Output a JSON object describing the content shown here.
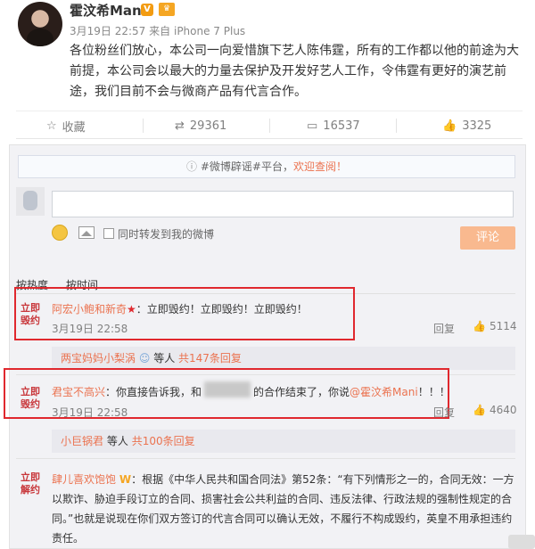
{
  "post": {
    "author": "霍汶希Mani",
    "badge": "V",
    "date": "3月19日 22:57",
    "source_prefix": "来自",
    "source": "iPhone 7 Plus",
    "text": "各位粉丝们放心，本公司一向爱惜旗下艺人陈伟霆，所有的工作都以他的前途为大前提，本公司会以最大的力量去保护及开发好艺人工作，令伟霆有更好的演艺前途，我们目前不会与微商产品有代言合作。"
  },
  "actions": {
    "favorite": "收藏",
    "repost": "29361",
    "comment": "16537",
    "like": "3325"
  },
  "comment_area": {
    "notice_tag": "#微博辟谣#平台，",
    "notice_link": "欢迎查阅！",
    "repost_label": "同时转发到我的微博",
    "submit": "评论",
    "tab_hot": "按热度",
    "tab_time": "按时间"
  },
  "comments": [
    {
      "stamp": "立即毁约",
      "name": "阿宏小鲍和新奇",
      "text": "：立即毁约！立即毁约！立即毁约！",
      "time": "3月19日 22:58",
      "reply": "回复",
      "likes": "5114",
      "sub_names": "两宝妈妈小梨涡",
      "sub_mid": "等人",
      "sub_count": "共147条回复"
    },
    {
      "stamp": "立即毁约",
      "name": "君宝不高兴",
      "text_a": "：你直接告诉我，和",
      "text_b": "的合作结束了，你说",
      "mention": "@霍汶希Mani",
      "text_c": "！！！",
      "time": "3月19日 22:58",
      "reply": "回复",
      "likes": "4640",
      "sub_names": "小巨锅君",
      "sub_mid": "等人",
      "sub_count": "共100条回复"
    },
    {
      "stamp": "立即解约",
      "name": "肆儿喜欢饱饱",
      "badge": "W",
      "text": "：根据《中华人民共和国合同法》第52条：“有下列情形之一的，合同无效：一方以欺诈、胁迫手段订立的合同、损害社会公共利益的合同、违反法律、行政法规的强制性规定的合同。”也就是说现在你们双方签订的代言合同可以确认无效，不履行不构成毁约，英皇不用承担违约责任。"
    }
  ],
  "colors": {
    "accent": "#eb7350",
    "highlight": "#e0282e"
  }
}
